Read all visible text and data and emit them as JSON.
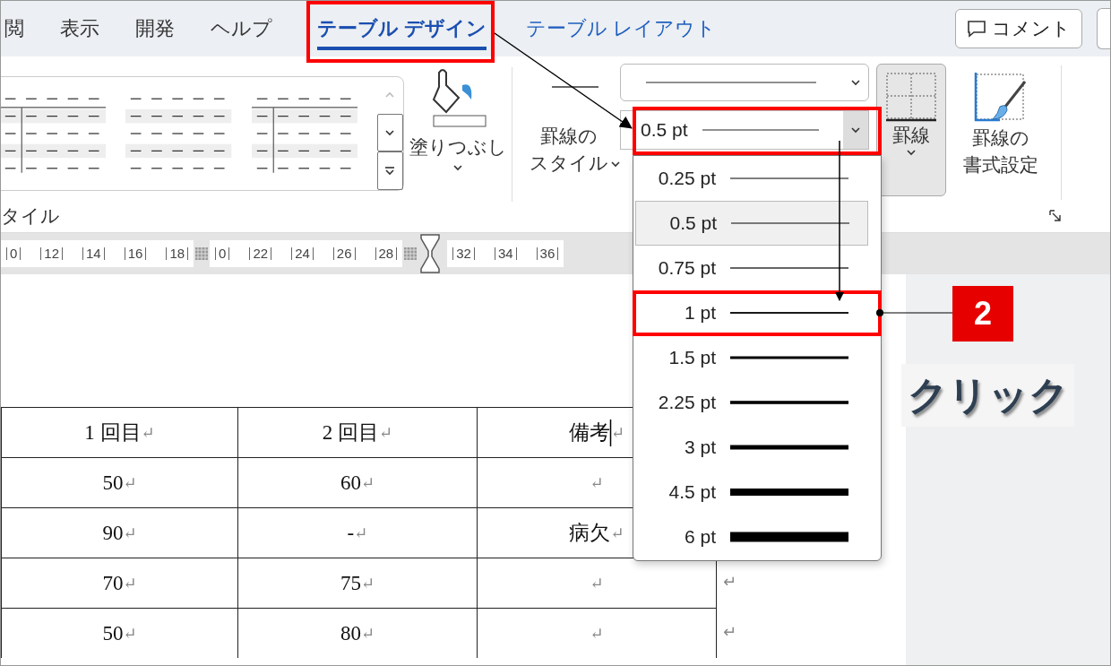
{
  "tabs": [
    {
      "label": "閲",
      "selected": false,
      "contextual": false
    },
    {
      "label": "表示",
      "selected": false,
      "contextual": false
    },
    {
      "label": "開発",
      "selected": false,
      "contextual": false
    },
    {
      "label": "ヘルプ",
      "selected": false,
      "contextual": false
    },
    {
      "label": "テーブル デザイン",
      "selected": true,
      "contextual": true
    },
    {
      "label": "テーブル レイアウト",
      "selected": false,
      "contextual": true
    }
  ],
  "comment_button": {
    "label": "コメント"
  },
  "ribbon": {
    "fill": {
      "label": "塗りつぶし"
    },
    "border_styles": {
      "lines": [
        "罫線の",
        "スタイル"
      ]
    },
    "pen_weight": {
      "value": "0.5 pt"
    },
    "borders": {
      "label": "罫線",
      "pressed": true
    },
    "border_painter": {
      "lines": [
        "罫線の",
        "書式設定"
      ]
    },
    "group_label": "タイル"
  },
  "ruler": {
    "labels": [
      "0",
      "12",
      "14",
      "16",
      "18",
      "0",
      "22",
      "24",
      "26",
      "28",
      "32",
      "34",
      "36"
    ]
  },
  "weight_menu": {
    "items": [
      {
        "label": "0.25 pt",
        "selected": false
      },
      {
        "label": "0.5 pt",
        "selected": true
      },
      {
        "label": "0.75 pt",
        "selected": false
      },
      {
        "label": "1 pt",
        "selected": false
      },
      {
        "label": "1.5 pt",
        "selected": false
      },
      {
        "label": "2.25 pt",
        "selected": false
      },
      {
        "label": "3 pt",
        "selected": false
      },
      {
        "label": "4.5 pt",
        "selected": false
      },
      {
        "label": "6 pt",
        "selected": false
      }
    ]
  },
  "table": {
    "rows": [
      {
        "cells": [
          {
            "text": "1 回目",
            "mark": "↵"
          },
          {
            "text": "2 回目",
            "mark": "↵"
          },
          {
            "text": "備考",
            "mark": "↵",
            "caret": true
          }
        ]
      },
      {
        "cells": [
          {
            "text": "50",
            "mark": "↵"
          },
          {
            "text": "60",
            "mark": "↵"
          },
          {
            "text": "",
            "mark": "↵"
          }
        ]
      },
      {
        "cells": [
          {
            "text": "90",
            "mark": "↵"
          },
          {
            "text": "-",
            "mark": "↵"
          },
          {
            "text": "病欠",
            "mark": "↵"
          }
        ]
      },
      {
        "cells": [
          {
            "text": "70",
            "mark": "↵"
          },
          {
            "text": "75",
            "mark": "↵"
          },
          {
            "text": "",
            "mark": "↵"
          }
        ],
        "end_mark": "↵"
      },
      {
        "cells": [
          {
            "text": "50",
            "mark": "↵"
          },
          {
            "text": "80",
            "mark": "↵"
          },
          {
            "text": "",
            "mark": "↵"
          }
        ],
        "end_mark": "↵"
      }
    ]
  },
  "annotations": {
    "step_badge": "2",
    "callout": "クリック"
  }
}
